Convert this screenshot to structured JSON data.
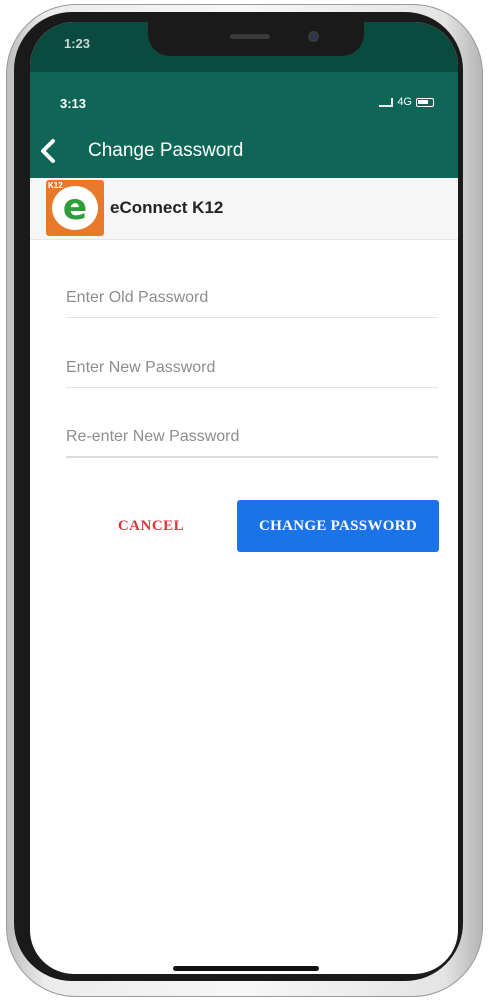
{
  "device": {
    "outer_status": {
      "time": "1:23",
      "icons": "..."
    }
  },
  "status_bar": {
    "time": "3:13",
    "network": "4G"
  },
  "header": {
    "back_icon": "chevron-left-icon",
    "title": "Change Password",
    "background_color": "#0f6657"
  },
  "brand": {
    "logo_letter": "e",
    "logo_tag": "K12",
    "name": "eConnect K12",
    "logo_color": "#e8792b"
  },
  "form": {
    "old_password": {
      "placeholder": "Enter Old Password",
      "value": ""
    },
    "new_password": {
      "placeholder": "Enter New Password",
      "value": ""
    },
    "confirm_password": {
      "placeholder": "Re-enter New Password",
      "value": ""
    }
  },
  "actions": {
    "cancel_label": "CANCEL",
    "submit_label": "CHANGE PASSWORD",
    "cancel_color": "#e0343a",
    "submit_color": "#1a73e8"
  }
}
